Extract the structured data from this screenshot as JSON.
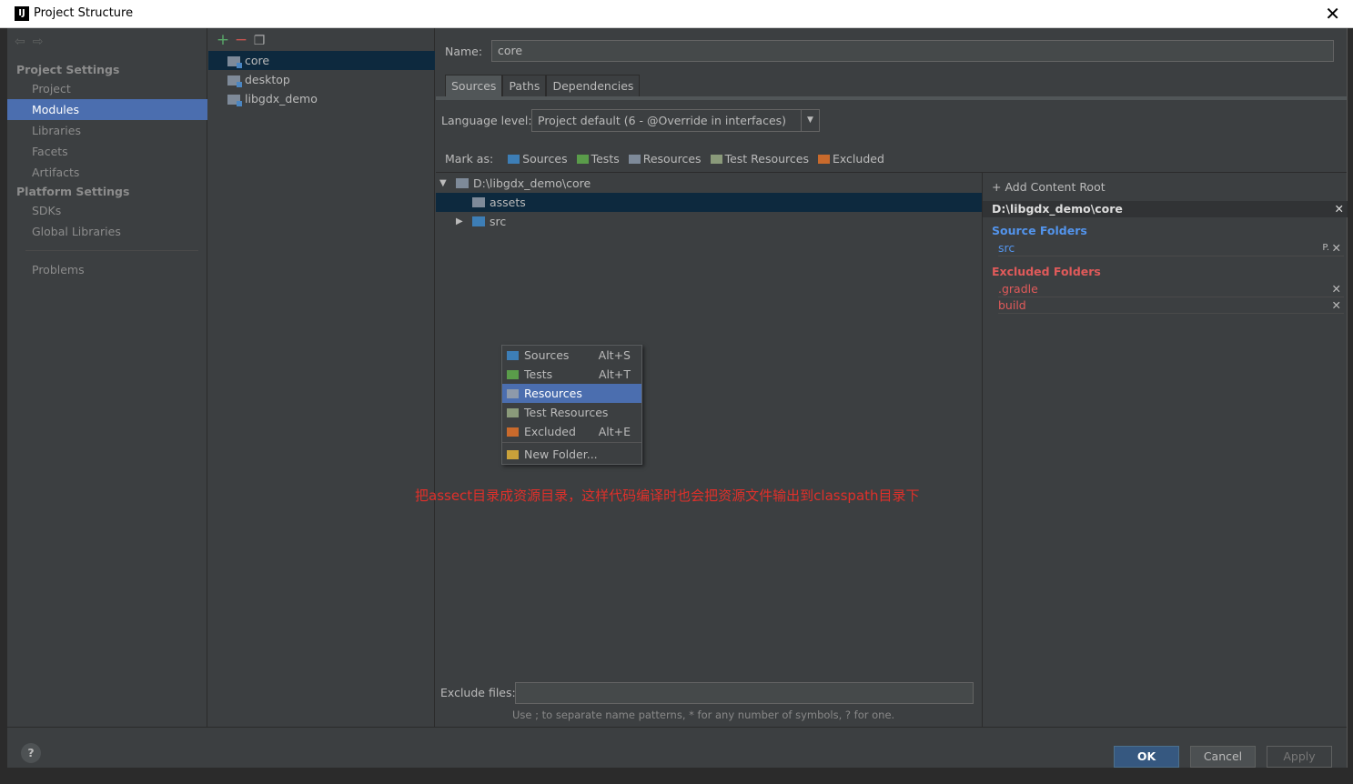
{
  "window": {
    "title": "Project Structure",
    "app_icon": "IJ"
  },
  "nav": {
    "project_settings": "Project Settings",
    "platform_settings": "Platform Settings",
    "items": [
      "Project",
      "Modules",
      "Libraries",
      "Facets",
      "Artifacts"
    ],
    "platform_items": [
      "SDKs",
      "Global Libraries"
    ],
    "problems": "Problems",
    "active": "Modules"
  },
  "modules": {
    "list": [
      "core",
      "desktop",
      "libgdx_demo"
    ],
    "active": "core"
  },
  "main": {
    "name_label": "Name:",
    "name_value": "core",
    "tabs": [
      "Sources",
      "Paths",
      "Dependencies"
    ],
    "active_tab": "Sources",
    "language_label": "Language level:",
    "language_value": "Project default (6 - @Override in interfaces)",
    "mark_as_label": "Mark as:",
    "mark_as": [
      "Sources",
      "Tests",
      "Resources",
      "Test Resources",
      "Excluded"
    ],
    "tree": {
      "root": "D:\\libgdx_demo\\core",
      "children": [
        "assets",
        "src"
      ]
    },
    "context_menu": [
      {
        "label": "Sources",
        "shortcut": "Alt+S"
      },
      {
        "label": "Tests",
        "shortcut": "Alt+T"
      },
      {
        "label": "Resources",
        "shortcut": ""
      },
      {
        "label": "Test Resources",
        "shortcut": ""
      },
      {
        "label": "Excluded",
        "shortcut": "Alt+E"
      },
      {
        "label": "New Folder...",
        "shortcut": ""
      }
    ],
    "annotation": "把assect目录成资源目录，这样代码编译时也会把资源文件输出到classpath目录下",
    "exclude_label": "Exclude files:",
    "exclude_value": "",
    "exclude_hint": "Use ; to separate name patterns, * for any number of symbols, ? for one."
  },
  "roots": {
    "add_label": "Add Content Root",
    "header": "D:\\libgdx_demo\\core",
    "source_title": "Source Folders",
    "source_folders": [
      "src"
    ],
    "excluded_title": "Excluded Folders",
    "excluded_folders": [
      ".gradle",
      "build"
    ]
  },
  "footer": {
    "ok": "OK",
    "cancel": "Cancel",
    "apply": "Apply"
  },
  "colors": {
    "accent": "#4b6eaf",
    "sources": "#3d7eb6",
    "tests": "#5a9c4a",
    "resources": "#7e8a99",
    "excluded": "#c96a2c",
    "source_title": "#5394ec",
    "excluded_title": "#e05a5a"
  }
}
